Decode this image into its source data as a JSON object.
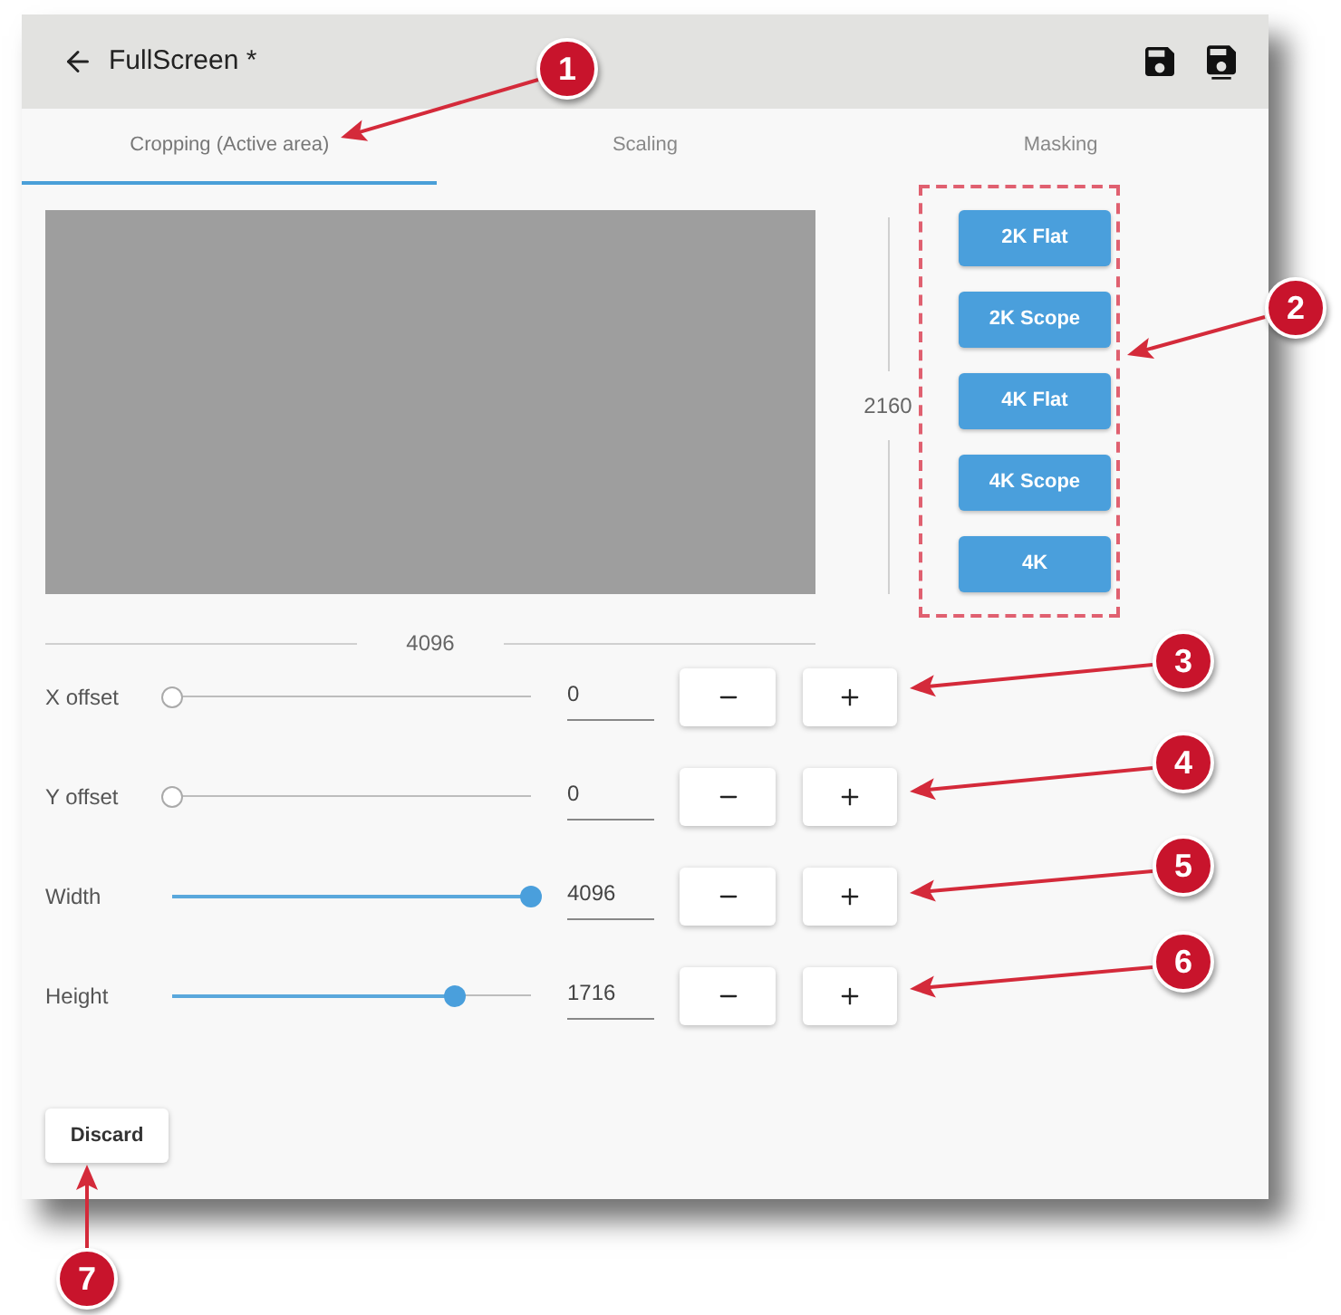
{
  "window": {
    "title": "FullScreen *"
  },
  "tabs": [
    {
      "label": "Cropping (Active area)",
      "selected": true
    },
    {
      "label": "Scaling",
      "selected": false
    },
    {
      "label": "Masking",
      "selected": false
    }
  ],
  "crop": {
    "height_value": "2160",
    "width_value": "4096"
  },
  "presets": [
    "2K Flat",
    "2K Scope",
    "4K Flat",
    "4K Scope",
    "4K"
  ],
  "rows": [
    {
      "label": "X offset",
      "level": 0,
      "value": "0"
    },
    {
      "label": "Y offset",
      "level": 0,
      "value": "0"
    },
    {
      "label": "Width",
      "level": 1,
      "value": "4096"
    },
    {
      "label": "Height",
      "level": 0.79,
      "value": "1716"
    }
  ],
  "discard_button": "Discard",
  "callouts": [
    "1",
    "2",
    "3",
    "4",
    "5",
    "6",
    "7"
  ]
}
